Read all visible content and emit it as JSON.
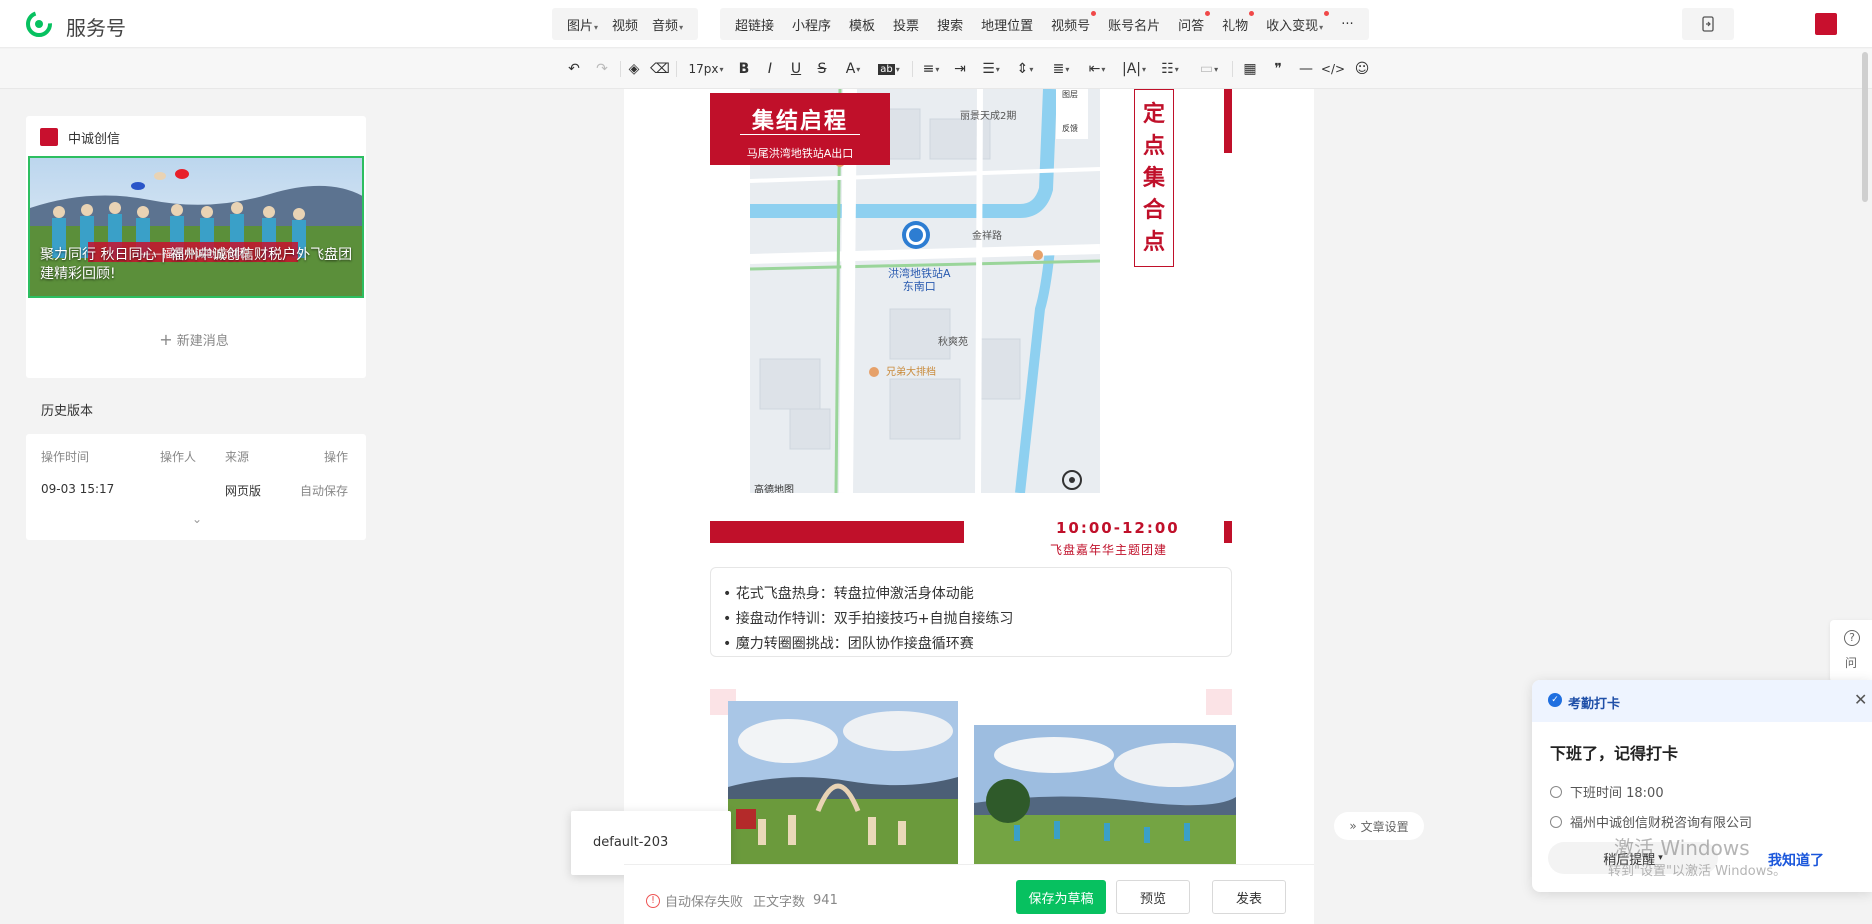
{
  "app": {
    "brand": "服务号"
  },
  "topnav": {
    "group1": [
      {
        "label": "图片",
        "caret": true
      },
      {
        "label": "视频",
        "caret": false
      },
      {
        "label": "音频",
        "caret": true
      }
    ],
    "group2": [
      {
        "label": "超链接",
        "caret": false,
        "dot": false
      },
      {
        "label": "小程序",
        "caret": false,
        "dot": false
      },
      {
        "label": "模板",
        "caret": false,
        "dot": false
      },
      {
        "label": "投票",
        "caret": false,
        "dot": false
      },
      {
        "label": "搜索",
        "caret": false,
        "dot": false
      },
      {
        "label": "地理位置",
        "caret": false,
        "dot": false
      },
      {
        "label": "视频号",
        "caret": false,
        "dot": true
      },
      {
        "label": "账号名片",
        "caret": false,
        "dot": false
      },
      {
        "label": "问答",
        "caret": false,
        "dot": true
      },
      {
        "label": "礼物",
        "caret": false,
        "dot": true
      },
      {
        "label": "收入变现",
        "caret": true,
        "dot": true
      }
    ],
    "more": "···"
  },
  "toolbar": {
    "font_size": "17px",
    "undo_icon": "undo-icon",
    "redo_icon": "redo-icon"
  },
  "sidebar": {
    "account_name": "中诚创信",
    "cover_title": "聚力同行 秋日同心 | 福州中诚创信财税户外飞盘团建精彩回顾!",
    "cover_banner": "——福州中诚创信财税",
    "new_message": "新建消息"
  },
  "history": {
    "title": "历史版本",
    "headers": [
      "操作时间",
      "操作人",
      "来源",
      "操作"
    ],
    "rows": [
      {
        "time": "09-03 15:17",
        "operator": "",
        "source": "网页版",
        "action": "自动保存"
      }
    ]
  },
  "article": {
    "banner_title": "集结启程",
    "banner_sub": "马尾洪湾地铁站A出口",
    "vertical_text": [
      "定",
      "点",
      "集",
      "合",
      "点"
    ],
    "map_labels": {
      "station": "洪湾地铁站A",
      "station_sub": "东南口",
      "road": "金祥路",
      "poi1": "兄弟大排档",
      "poi2": "秋爽苑",
      "poi3": "丽景天成2期",
      "feedback": "反馈",
      "layer": "图层",
      "brand": "高德地图"
    },
    "time_range": "10:00-12:00",
    "time_subtitle": "飞盘嘉年华主题团建",
    "activities": [
      "• 花式飞盘热身：转盘拉伸激活身体动能",
      "• 接盘动作特训：双手拍接技巧+自抛自接练习",
      "• 魔力转圈圈挑战：团队协作接盘循环赛"
    ]
  },
  "tooltip": {
    "text": "default-203"
  },
  "bottom": {
    "warning": "自动保存失败",
    "word_count_label": "正文字数",
    "word_count": "941",
    "save_draft": "保存为草稿",
    "preview": "预览",
    "publish": "发表",
    "article_settings": "文章设置"
  },
  "help": {
    "label": "问"
  },
  "notification": {
    "header": "考勤打卡",
    "title": "下班了，记得打卡",
    "off_time": "下班时间 18:00",
    "company": "福州中诚创信财税咨询有限公司",
    "later": "稍后提醒",
    "ok": "我知道了"
  },
  "watermark": {
    "line1": "激活 Windows",
    "line2": "转到\"设置\"以激活 Windows。"
  },
  "colors": {
    "brand_red": "#c0102a",
    "green": "#07c160",
    "link_blue": "#1a56db"
  }
}
